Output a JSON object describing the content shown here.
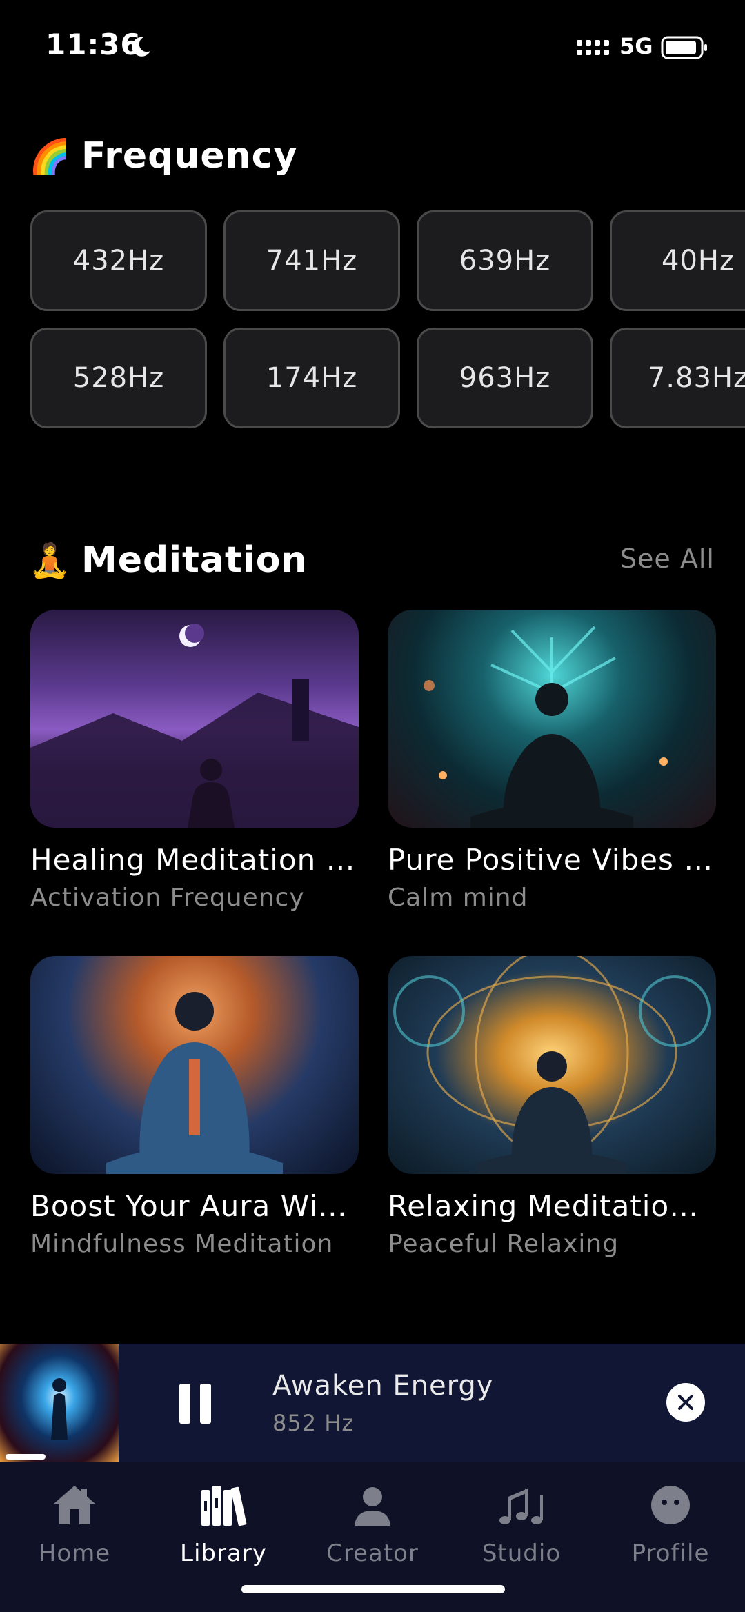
{
  "status_bar": {
    "time": "11:36",
    "network": "5G"
  },
  "frequency": {
    "emoji": "🌈",
    "title": "Frequency",
    "chips": [
      "432Hz",
      "741Hz",
      "639Hz",
      "40Hz",
      "528Hz",
      "174Hz",
      "963Hz",
      "7.83Hz"
    ]
  },
  "meditation": {
    "emoji": "🧘",
    "title": "Meditation",
    "see_all": "See All",
    "cards": [
      {
        "title": "Healing Meditation f...",
        "subtitle": "Activation Frequency"
      },
      {
        "title": "Pure Positive Vibes t...",
        "subtitle": "Calm mind"
      },
      {
        "title": "Boost Your Aura Wit...",
        "subtitle": "Mindfulness Meditation"
      },
      {
        "title": "Relaxing Meditation ...",
        "subtitle": "Peaceful Relaxing"
      }
    ]
  },
  "player": {
    "title": "Awaken Energy",
    "subtitle": "852 Hz"
  },
  "tabs": [
    {
      "label": "Home",
      "icon": "home-icon"
    },
    {
      "label": "Library",
      "icon": "library-icon"
    },
    {
      "label": "Creator",
      "icon": "person-icon"
    },
    {
      "label": "Studio",
      "icon": "music-notes-icon"
    },
    {
      "label": "Profile",
      "icon": "face-icon"
    }
  ],
  "colors": {
    "background": "#000000",
    "chip_bg": "#1c1c1e",
    "player_bg": "#101633",
    "tabbar_bg": "#0f1227",
    "muted_text": "#8c8c8c"
  }
}
